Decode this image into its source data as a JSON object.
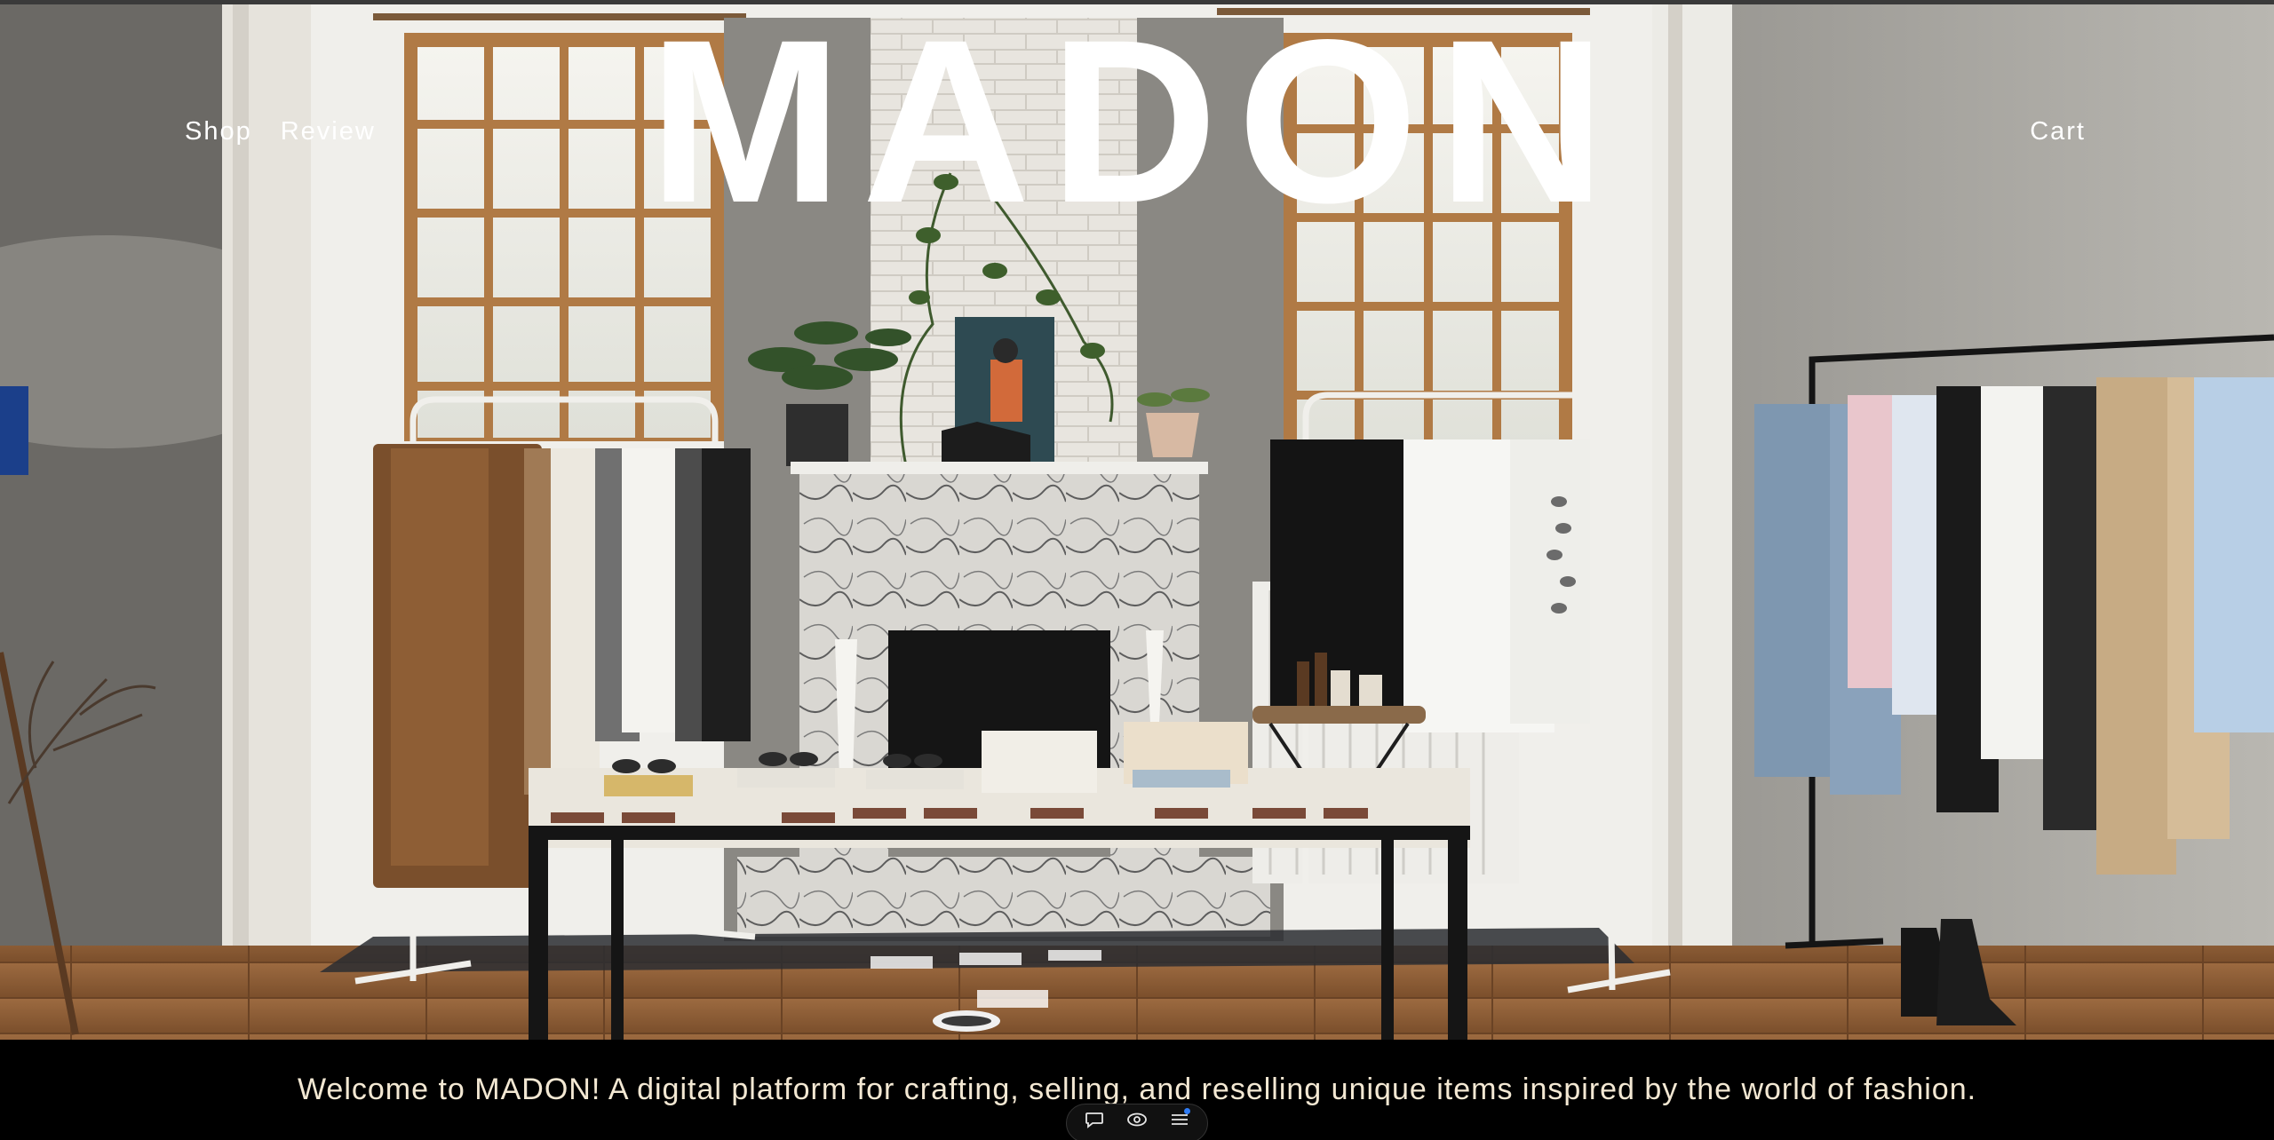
{
  "brand": {
    "name": "MADON"
  },
  "nav": {
    "left_links": [
      "Shop",
      "Review"
    ],
    "cart_label": "Cart"
  },
  "hero": {
    "image_icon": "boutique-photo"
  },
  "welcome": {
    "text": "Welcome to MADON! A digital platform for crafting, selling, and reselling unique items inspired by the world of fashion."
  },
  "toolbar": {
    "buttons": [
      {
        "icon": "chat-bubble-icon"
      },
      {
        "icon": "eye-icon"
      },
      {
        "icon": "menu-icon"
      }
    ],
    "notification_color": "#2f7cf6"
  },
  "colors": {
    "text_on_hero": "#ffffff",
    "welcome_text": "#f3e8d3",
    "footer_bg": "#000000"
  }
}
